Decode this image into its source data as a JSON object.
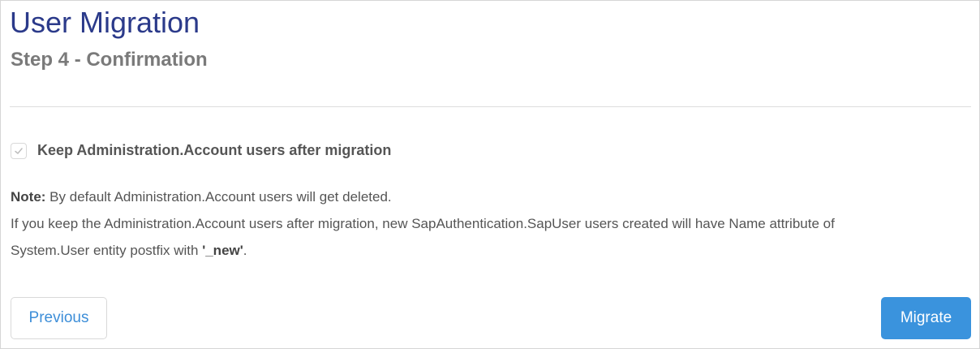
{
  "header": {
    "title": "User Migration",
    "subtitle": "Step 4 - Confirmation"
  },
  "options": {
    "keep_users_label": "Keep Administration.Account users after migration",
    "keep_users_checked": true,
    "checkbox_icon": "check-icon"
  },
  "note": {
    "prefix": "Note:",
    "line1_rest": " By default Administration.Account users will get deleted.",
    "line2": "If you keep the Administration.Account users after migration, new SapAuthentication.SapUser users created will have Name attribute of",
    "line3_start": "System.User entity postfix with ",
    "postfix_value": "'_new'",
    "line3_end": "."
  },
  "actions": {
    "previous_label": "Previous",
    "migrate_label": "Migrate"
  },
  "colors": {
    "title": "#2b3a8a",
    "primary_button": "#3a93dd",
    "link_text": "#3d8ed8"
  }
}
